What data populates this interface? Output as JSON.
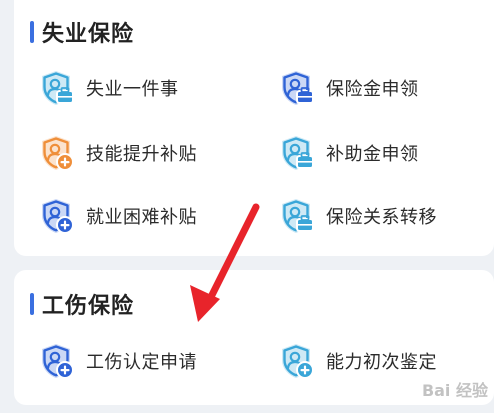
{
  "colors": {
    "accent": "#3a6fe0",
    "arrow": "#e8242b",
    "icon_teal": "#3aa6d8",
    "icon_orange": "#ef8f3a",
    "icon_blue": "#2f63d6"
  },
  "unemployment": {
    "title": "失业保险",
    "items": [
      {
        "label": "失业一件事",
        "icon": "shield-briefcase-icon",
        "color": "#3aa6d8",
        "badge": "briefcase"
      },
      {
        "label": "保险金申领",
        "icon": "shield-briefcase-icon",
        "color": "#2f63d6",
        "badge": "briefcase"
      },
      {
        "label": "技能提升补贴",
        "icon": "shield-plus-icon",
        "color": "#ef8f3a",
        "badge": "plus"
      },
      {
        "label": "补助金申领",
        "icon": "shield-briefcase-icon",
        "color": "#3aa6d8",
        "badge": "briefcase"
      },
      {
        "label": "就业困难补贴",
        "icon": "shield-plus-icon",
        "color": "#2f63d6",
        "badge": "plus"
      },
      {
        "label": "保险关系转移",
        "icon": "shield-briefcase-icon",
        "color": "#3aa6d8",
        "badge": "briefcase"
      }
    ]
  },
  "injury": {
    "title": "工伤保险",
    "items": [
      {
        "label": "工伤认定申请",
        "icon": "shield-plus-icon",
        "color": "#2f63d6",
        "badge": "plus"
      },
      {
        "label": "能力初次鉴定",
        "icon": "shield-plus-icon",
        "color": "#3aa6d8",
        "badge": "plus"
      }
    ]
  },
  "watermark": "Bai 经验"
}
